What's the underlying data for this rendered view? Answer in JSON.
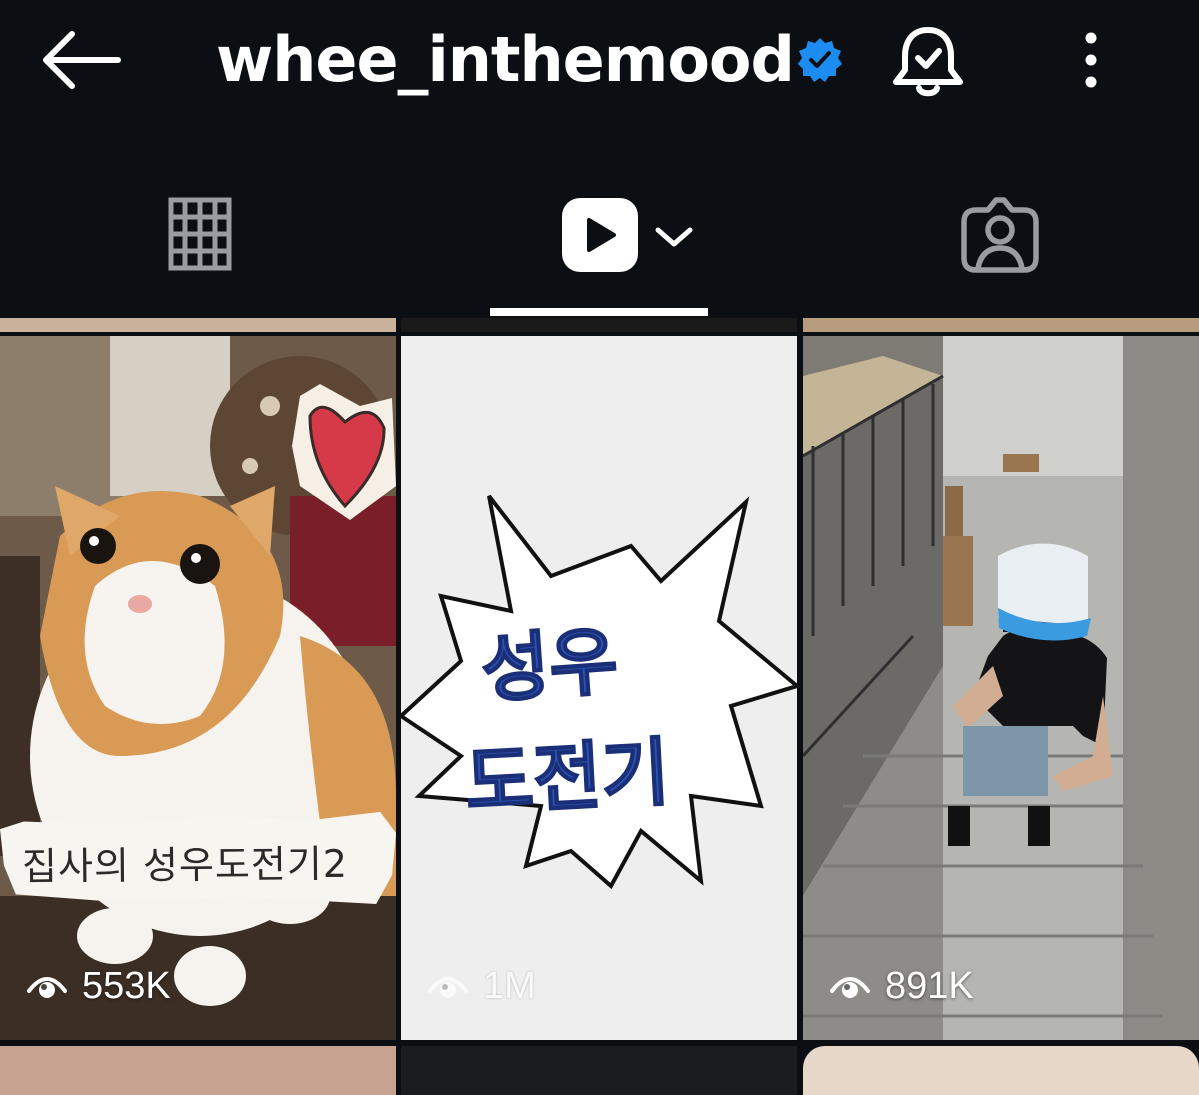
{
  "header": {
    "username": "whee_inthemood",
    "verified": true,
    "icons": [
      "back-arrow-icon",
      "verified-badge-icon",
      "bell-check-icon",
      "more-vertical-icon"
    ]
  },
  "tabs": [
    {
      "name": "grid",
      "icon": "grid-icon",
      "active": false
    },
    {
      "name": "reels",
      "icon": "reels-play-icon",
      "active": true
    },
    {
      "name": "tagged",
      "icon": "tagged-person-icon",
      "active": false
    }
  ],
  "reels": [
    {
      "caption": "집사의 성우도전기2",
      "views": "553K"
    },
    {
      "title_line1": "성우",
      "title_line2": "도전기",
      "views": "1M"
    },
    {
      "views": "891K"
    }
  ],
  "colors": {
    "background": "#0b0e13",
    "verified": "#1d8cf0",
    "burst_text": "#2b55b5"
  }
}
